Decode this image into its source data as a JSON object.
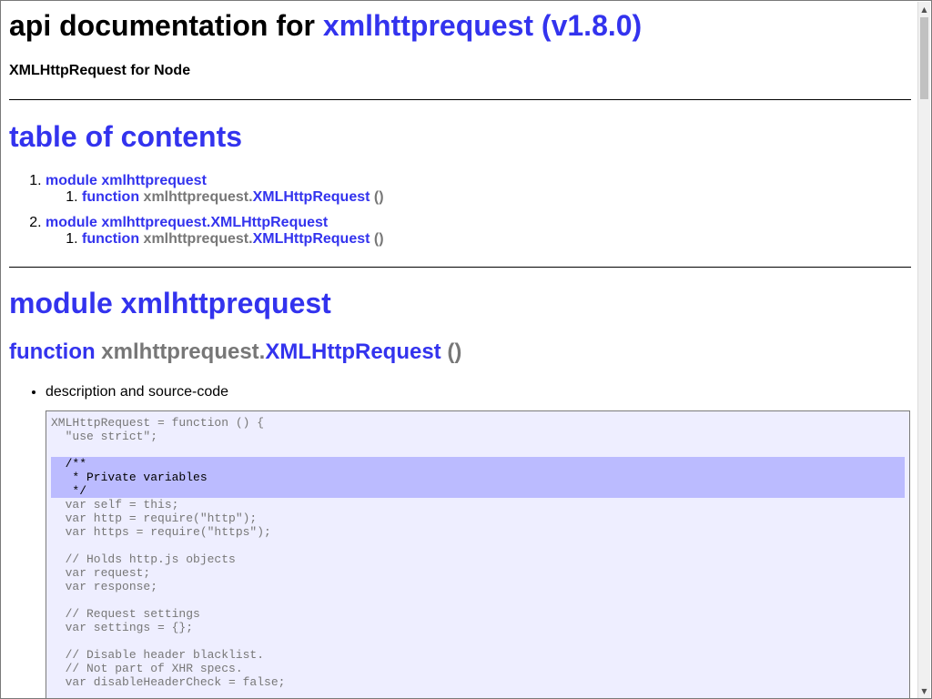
{
  "header": {
    "title_prefix": "api documentation for ",
    "title_link": "xmlhttprequest (v1.8.0)",
    "subtitle": "XMLHttpRequest for Node"
  },
  "toc": {
    "heading": "table of contents",
    "items": [
      {
        "number": "1.",
        "label": "module xmlhttprequest",
        "children": [
          {
            "number": "1.",
            "keyword": "function",
            "namespace": "xmlhttprequest.",
            "name": "XMLHttpRequest",
            "signature": " ()"
          }
        ]
      },
      {
        "number": "2.",
        "label": "module xmlhttprequest.XMLHttpRequest",
        "children": [
          {
            "number": "1.",
            "keyword": "function",
            "namespace": "xmlhttprequest.",
            "name": "XMLHttpRequest",
            "signature": " ()"
          }
        ]
      }
    ]
  },
  "module": {
    "heading": "module xmlhttprequest",
    "function": {
      "keyword": "function",
      "namespace": " xmlhttprequest.",
      "name": "XMLHttpRequest",
      "signature": " ()"
    },
    "bullet": "description and source-code",
    "code_lines": [
      {
        "text": "XMLHttpRequest = function () {",
        "highlight": false
      },
      {
        "text": "  \"use strict\";",
        "highlight": false
      },
      {
        "text": "",
        "highlight": false
      },
      {
        "text": "  /**",
        "highlight": true
      },
      {
        "text": "   * Private variables",
        "highlight": true
      },
      {
        "text": "   */",
        "highlight": true
      },
      {
        "text": "  var self = this;",
        "highlight": false
      },
      {
        "text": "  var http = require(\"http\");",
        "highlight": false
      },
      {
        "text": "  var https = require(\"https\");",
        "highlight": false
      },
      {
        "text": "",
        "highlight": false
      },
      {
        "text": "  // Holds http.js objects",
        "highlight": false
      },
      {
        "text": "  var request;",
        "highlight": false
      },
      {
        "text": "  var response;",
        "highlight": false
      },
      {
        "text": "",
        "highlight": false
      },
      {
        "text": "  // Request settings",
        "highlight": false
      },
      {
        "text": "  var settings = {};",
        "highlight": false
      },
      {
        "text": "",
        "highlight": false
      },
      {
        "text": "  // Disable header blacklist.",
        "highlight": false
      },
      {
        "text": "  // Not part of XHR specs.",
        "highlight": false
      },
      {
        "text": "  var disableHeaderCheck = false;",
        "highlight": false
      },
      {
        "text": "",
        "highlight": false
      }
    ]
  },
  "scrollbar": {
    "up_icon": "triangle-up",
    "down_icon": "triangle-down",
    "scroll_position": 0.0
  },
  "colors": {
    "link": "#3333ee",
    "muted": "#777777",
    "code_bg": "#eeeeff",
    "code_highlight": "#bbbbff"
  }
}
